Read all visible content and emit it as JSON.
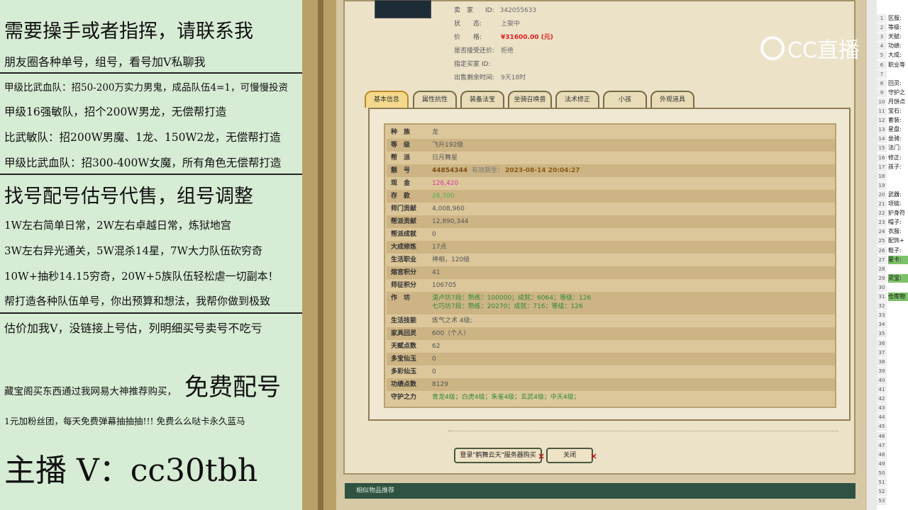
{
  "overlay": {
    "lines": [
      "需要操手或者指挥，请联系我",
      "朋友圈各种单号，组号，看号加V私聊我",
      "甲级比武血队：招50-200万实力男鬼，成品队伍4=1，可慢慢投资",
      "甲级16强敏队，招个200W男龙，无偿帮打造",
      "比武敏队：招200W男魔、1龙、150W2龙，无偿帮打造",
      "甲级比武血队：招300-400W女魔，所有角色无偿帮打造",
      "找号配号估号代售，组号调整",
      "1W左右简单日常，2W左右卓越日常，炼狱地宫",
      "3W左右异光通关，5W混杀14星，7W大力队伍砍穷奇",
      "10W+抽秒14.15穷奇，20W+5族队伍轻松虐一切副本！",
      "帮打造各种队伍单号，你出预算和想法，我帮你做到极致",
      "估价加我V，没链接上号估，列明细买号卖号不吃亏",
      "藏宝阁买东西通过我网易大神推荐购买，",
      "免费配号",
      "1元加粉丝团，每天免费弹幕抽抽抽!!! 免费么么哒卡永久蓝马",
      "主播 V：cc30tbh"
    ]
  },
  "seller_info": {
    "seller_label": "卖　家",
    "seller_id_label": "ID:",
    "seller_id": "342055633",
    "status_label": "状　　态:",
    "status": "上架中",
    "price_label": "价　　格:",
    "price": "¥31600.00 (元)",
    "bargain_label": "是否接受还价:",
    "bargain": "拒绝",
    "buyer_label": "指定买家 ID:",
    "buyer": "",
    "remain_label": "出售剩余时间:",
    "remain": "9天18时"
  },
  "tabs": [
    "基本信息",
    "属性抗性",
    "装备法宝",
    "坐骑召唤兽",
    "法术修正",
    "小孩",
    "外观道具"
  ],
  "rows": [
    {
      "label": "种　族",
      "value": "龙"
    },
    {
      "label": "等　级",
      "value": "飞升192级"
    },
    {
      "label": "帮　派",
      "value": "日月舞星"
    },
    {
      "label": "靓　号",
      "value": "44854344",
      "extra": "有效期至：",
      "date": "2023-08-14 20:04:27"
    },
    {
      "label": "现　金",
      "value": "126,420"
    },
    {
      "label": "存　款",
      "value": "26,700"
    },
    {
      "label": "师门贡献",
      "value": "4,008,960"
    },
    {
      "label": "帮派贡献",
      "value": "12,890,344"
    },
    {
      "label": "帮派成就",
      "value": "0"
    },
    {
      "label": "大成修炼",
      "value": "17点"
    },
    {
      "label": "生活职业",
      "value": "神相，120级"
    },
    {
      "label": "熔宫积分",
      "value": "41"
    },
    {
      "label": "师征积分",
      "value": "106705"
    },
    {
      "label": "作　坊",
      "value": "湛卢坊7段：熟练：100000；成就：6064；等级：126",
      "value2": "七巧坊7段：熟练：20270；成就：716；等级：126"
    },
    {
      "label": "生活技能",
      "value": "炼气之术 4级;"
    },
    {
      "label": "家具回灵",
      "value": "600（个人）"
    },
    {
      "label": "天赋点数",
      "value": "62"
    },
    {
      "label": "多宝仙玉",
      "value": "0"
    },
    {
      "label": "多彩仙玉",
      "value": "0"
    },
    {
      "label": "功绩点数",
      "value": "8129"
    },
    {
      "label": "守护之力",
      "value": "青龙4级；白虎4级；朱雀4级；玄武4级；中天4级；"
    }
  ],
  "buttons": {
    "buy": "登录\"鹤舞云天\"服务器购买",
    "close": "关闭"
  },
  "similar_label": "相似物品推荐",
  "watermark": "CC直播",
  "sheet": {
    "rows": [
      "区服:",
      "等级:",
      "天赋:",
      "功绩:",
      "大成:",
      "职业等",
      "",
      "回灵:",
      "守护之",
      "月饼点",
      "宝石:",
      "套装:",
      "星盘:",
      "坐骑:",
      "法门:",
      "修正:",
      "孩子:",
      "",
      "",
      "武器:",
      "项链:",
      "护身符",
      "帽子:",
      "衣服:",
      "配饰+",
      "鞋子:",
      "星卡:",
      "",
      "灵宝:",
      "",
      "仓库物",
      "",
      "",
      "",
      "",
      "",
      "",
      "",
      "",
      "",
      "",
      "",
      "",
      "",
      "",
      "",
      "",
      "",
      "",
      "",
      "",
      "",
      ""
    ]
  },
  "colors": {
    "accent_price": "#e02020",
    "cash": "#d43aa0",
    "deposit": "#4ab04a",
    "date": "#8a5a14"
  }
}
